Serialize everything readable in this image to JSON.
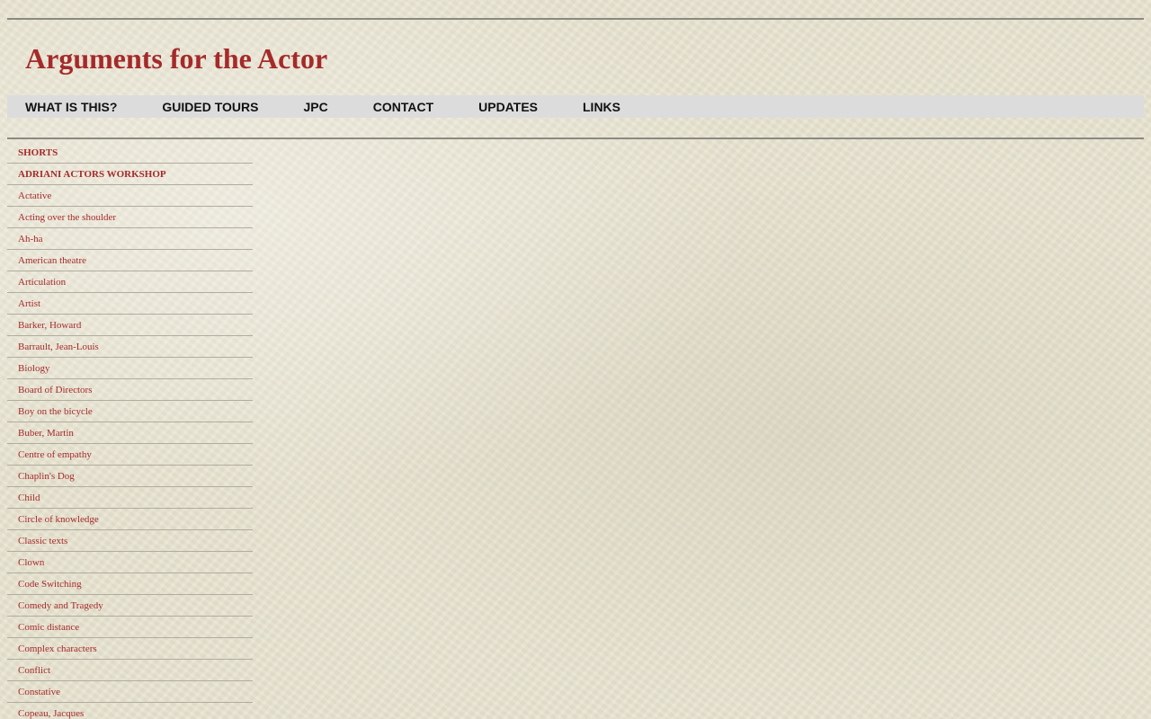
{
  "site": {
    "title": "Arguments for the Actor"
  },
  "nav": {
    "items": [
      {
        "label": "WHAT IS THIS?"
      },
      {
        "label": "GUIDED TOURS"
      },
      {
        "label": "JPC"
      },
      {
        "label": "CONTACT"
      },
      {
        "label": "UPDATES"
      },
      {
        "label": "LINKS"
      }
    ]
  },
  "sidebar": {
    "items": [
      {
        "label": "SHORTS"
      },
      {
        "label": "ADRIANI ACTORS WORKSHOP"
      },
      {
        "label": "Actative"
      },
      {
        "label": "Acting over the shoulder"
      },
      {
        "label": "Ah-ha"
      },
      {
        "label": "American theatre"
      },
      {
        "label": "Articulation"
      },
      {
        "label": "Artist"
      },
      {
        "label": "Barker, Howard"
      },
      {
        "label": "Barrault, Jean-Louis"
      },
      {
        "label": "Biology"
      },
      {
        "label": "Board of Directors"
      },
      {
        "label": "Boy on the bicycle"
      },
      {
        "label": "Buber, Martin"
      },
      {
        "label": "Centre of empathy"
      },
      {
        "label": "Chaplin's Dog"
      },
      {
        "label": "Child"
      },
      {
        "label": "Circle of knowledge"
      },
      {
        "label": "Classic texts"
      },
      {
        "label": "Clown"
      },
      {
        "label": "Code Switching"
      },
      {
        "label": "Comedy and Tragedy"
      },
      {
        "label": "Comic distance"
      },
      {
        "label": "Complex characters"
      },
      {
        "label": "Conflict"
      },
      {
        "label": "Constative"
      },
      {
        "label": "Copeau, Jacques"
      }
    ]
  },
  "colors": {
    "title": "#a52a2a",
    "link": "#a52a2a",
    "nav_bg": "#dcdcdc",
    "page_bg": "#e6e2cf"
  }
}
